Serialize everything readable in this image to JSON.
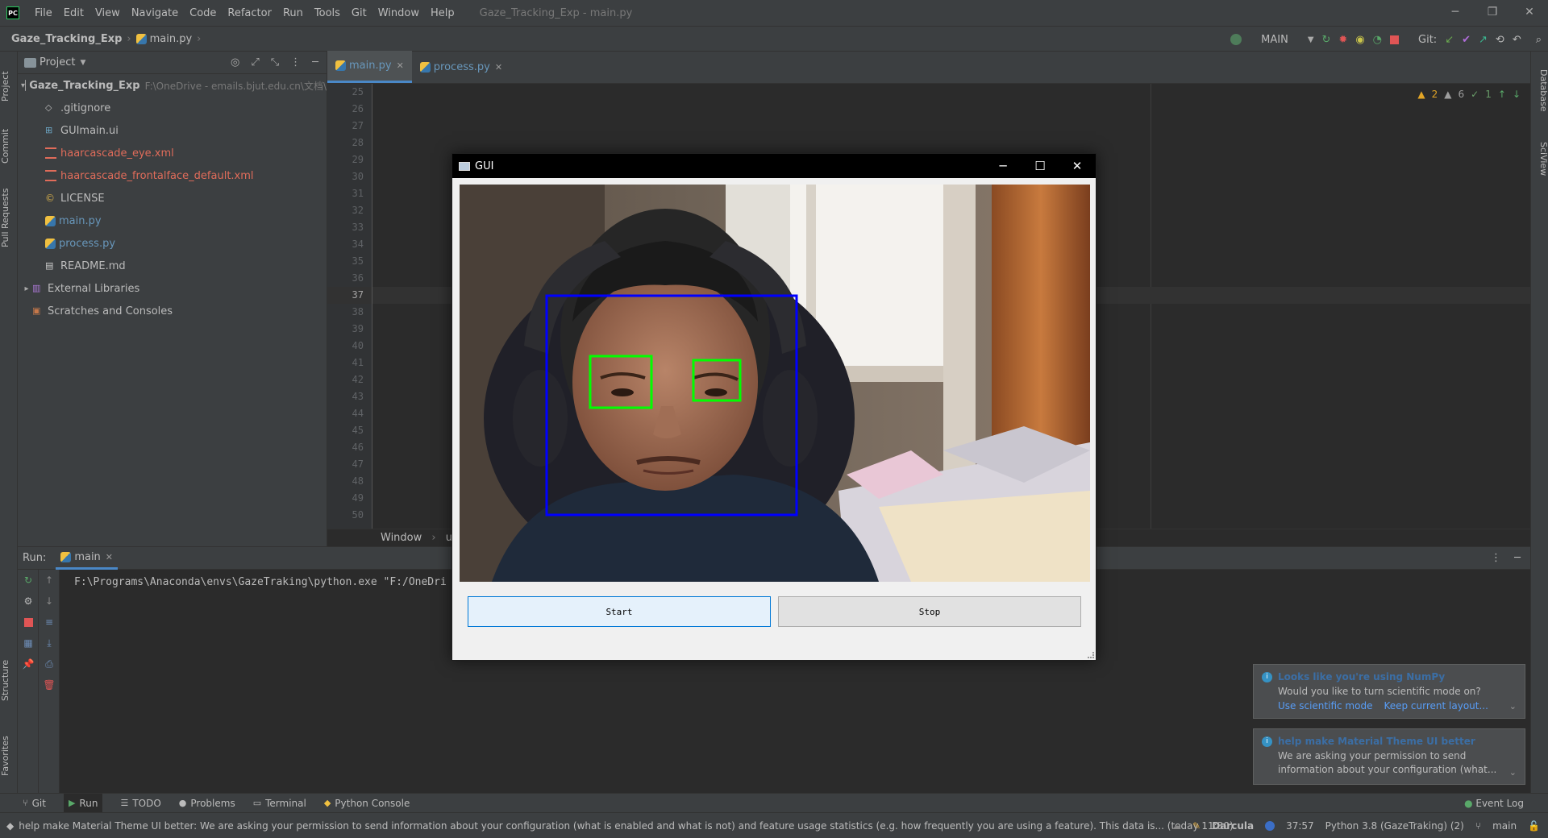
{
  "app": {
    "menu": [
      "File",
      "Edit",
      "View",
      "Navigate",
      "Code",
      "Refactor",
      "Run",
      "Tools",
      "Git",
      "Window",
      "Help"
    ],
    "window_title": "Gaze_Tracking_Exp - main.py",
    "logo": "PC"
  },
  "navbar": {
    "project": "Gaze_Tracking_Exp",
    "file": "main.py",
    "run_config": "MAIN",
    "git_label": "Git:"
  },
  "project_panel": {
    "title": "Project",
    "root": "Gaze_Tracking_Exp",
    "root_path": "F:\\OneDrive - emails.bjut.edu.cn\\文档\\",
    "files": [
      {
        "name": ".gitignore",
        "kind": "plain"
      },
      {
        "name": "GUImain.ui",
        "kind": "ui"
      },
      {
        "name": "haarcascade_eye.xml",
        "kind": "xml"
      },
      {
        "name": "haarcascade_frontalface_default.xml",
        "kind": "xml"
      },
      {
        "name": "LICENSE",
        "kind": "license"
      },
      {
        "name": "main.py",
        "kind": "py"
      },
      {
        "name": "process.py",
        "kind": "py"
      },
      {
        "name": "README.md",
        "kind": "md"
      }
    ],
    "external_libraries": "External Libraries",
    "scratches": "Scratches and Consoles"
  },
  "editor": {
    "tabs": [
      "main.py",
      "process.py"
    ],
    "line_numbers": [
      "25",
      "26",
      "27",
      "28",
      "29",
      "30",
      "31",
      "32",
      "33",
      "34",
      "35",
      "36",
      "37",
      "38",
      "39",
      "40",
      "41",
      "42",
      "43",
      "44",
      "45",
      "46",
      "47",
      "48",
      "49",
      "50"
    ],
    "current_line": "37",
    "inspections": {
      "warnings": "2",
      "weak_warnings": "6",
      "typos": "1"
    },
    "breadcrumb": [
      "Window",
      "up"
    ]
  },
  "run_panel": {
    "label": "Run:",
    "tab": "main",
    "console_line": "F:\\Programs\\Anaconda\\envs\\GazeTraking\\python.exe \"F:/OneDri"
  },
  "gui_window": {
    "title": "GUI",
    "start_label": "Start",
    "stop_label": "Stop"
  },
  "notifications": [
    {
      "title": "Looks like you're using NumPy",
      "body": "Would you like to turn scientific mode on?",
      "links": [
        "Use scientific mode",
        "Keep current layout..."
      ]
    },
    {
      "title": "help make Material Theme UI better",
      "body": "We are asking your permission to send information about your configuration (what..."
    }
  ],
  "bottom_tools": [
    "Git",
    "Run",
    "TODO",
    "Problems",
    "Terminal",
    "Python Console"
  ],
  "event_log": "Event Log",
  "side_tabs_left": [
    "Project",
    "Commit",
    "Pull Requests",
    "Structure",
    "Favorites"
  ],
  "side_tabs_right": [
    "Database",
    "SciView"
  ],
  "status": {
    "message": "help make Material Theme UI better: We are asking your permission to send information about your configuration (what is enabled and what is not) and feature usage statistics (e.g. how frequently you are using a feature). This data is... (today 11:30)",
    "theme": "Darcula",
    "position": "37:57",
    "interpreter": "Python 3.8 (GazeTraking) (2)",
    "branch": "main"
  }
}
